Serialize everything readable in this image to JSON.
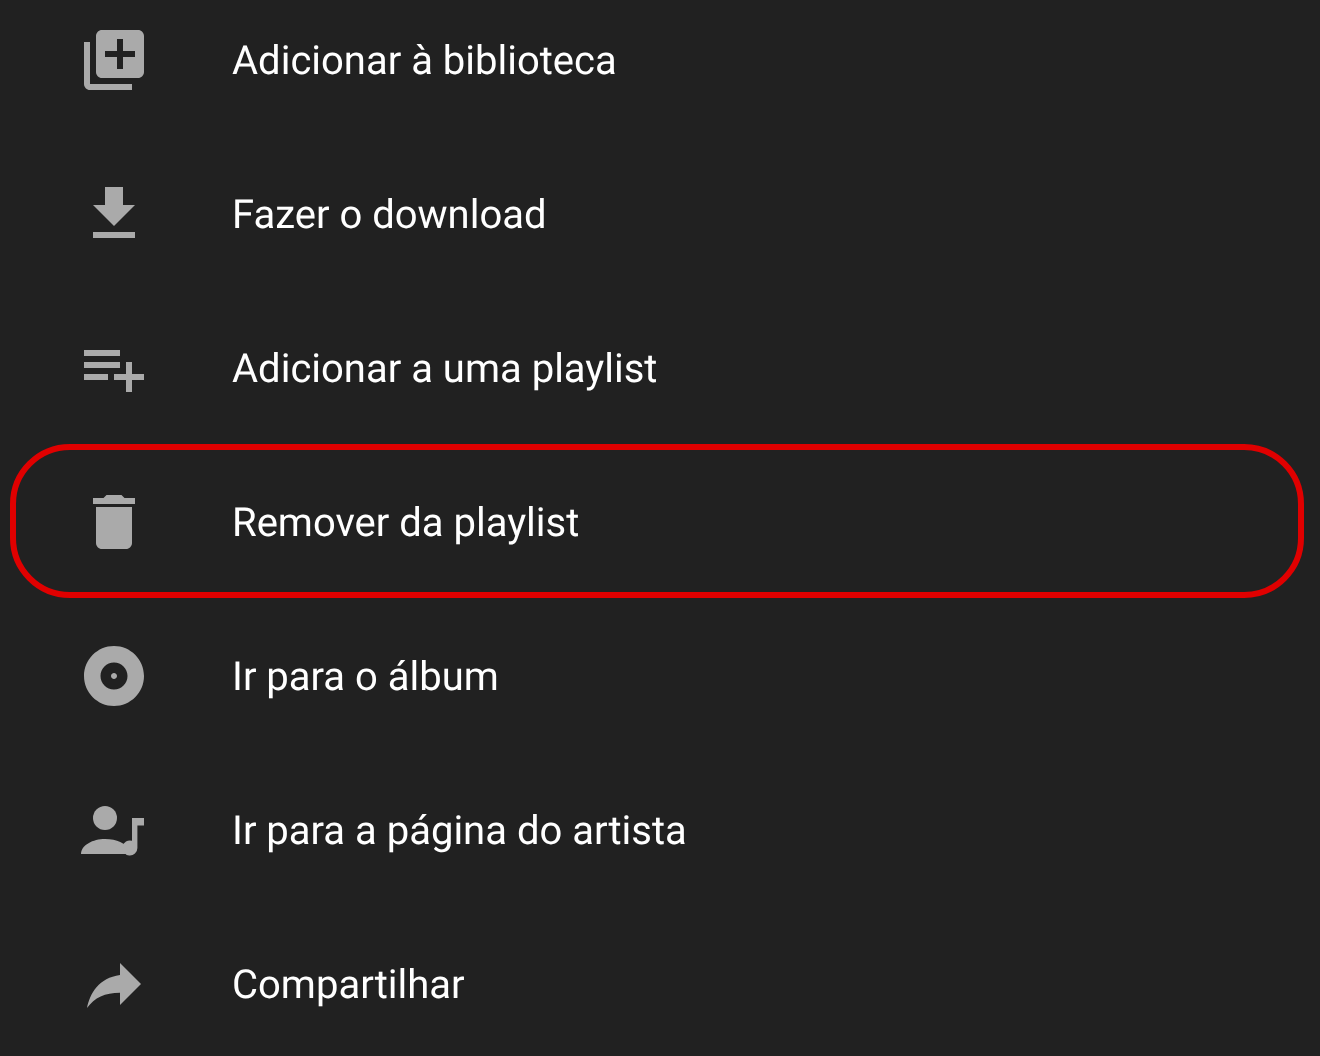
{
  "menu": {
    "items": [
      {
        "label": "Adicionar à biblioteca",
        "highlighted": false
      },
      {
        "label": "Fazer o download",
        "highlighted": false
      },
      {
        "label": "Adicionar a uma playlist",
        "highlighted": false
      },
      {
        "label": "Remover da playlist",
        "highlighted": true
      },
      {
        "label": "Ir para o álbum",
        "highlighted": false
      },
      {
        "label": "Ir para a página do artista",
        "highlighted": false
      },
      {
        "label": "Compartilhar",
        "highlighted": false
      }
    ]
  }
}
